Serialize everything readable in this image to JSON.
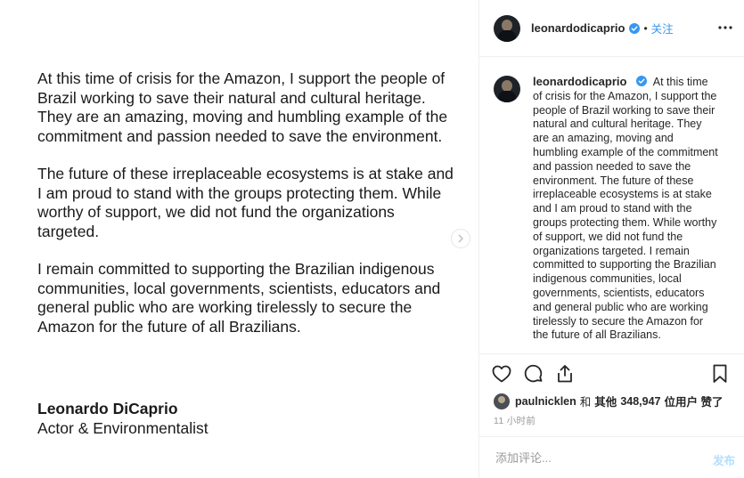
{
  "image": {
    "paragraphs": [
      "At this time of crisis for the Amazon, I support the people of Brazil working to save their natural and cultural heritage. They are an amazing, moving and humbling example of the commitment and passion needed to save the environment.",
      "The future of these irreplaceable ecosystems is at stake and I am proud to stand with the groups protecting them. While worthy of support, we did not fund the organizations targeted.",
      "I remain committed to supporting the Brazilian indigenous communities, local governments, scientists, educators and general public who are working tirelessly to secure the Amazon for the future of all Brazilians."
    ],
    "signature_name": "Leonardo DiCaprio",
    "signature_title": "Actor & Environmentalist"
  },
  "header": {
    "username": "leonardodicaprio",
    "separator": "•",
    "follow_label": "关注"
  },
  "caption": {
    "username": "leonardodicaprio",
    "text": "At this time of crisis for the Amazon, I support the people of Brazil working to save their natural and cultural heritage. They are an amazing, moving and humbling example of the commitment and passion needed to save the environment. The future of these irreplaceable ecosystems is at stake and I am proud to stand with the groups protecting them. While worthy of support, we did not fund the organizations targeted. I remain committed to supporting the Brazilian indigenous communities, local governments, scientists, educators and general public who are working tirelessly to secure the Amazon for the future of all Brazilians."
  },
  "likes": {
    "user": "paulnicklen",
    "connector": "和",
    "others_label": "其他",
    "count": "348,947",
    "suffix": "位用户 赞了"
  },
  "timestamp": "11 小时前",
  "comment_box": {
    "placeholder": "添加评论...",
    "post_label": "发布"
  },
  "icons": {
    "next": "chevron-right-icon",
    "more": "more-options-icon",
    "verified": "verified-badge-icon",
    "like": "heart-icon",
    "comment": "comment-bubble-icon",
    "share": "share-icon",
    "save": "bookmark-icon"
  },
  "colors": {
    "link": "#3897f0",
    "verified": "#3897f0",
    "muted": "#999999",
    "post_disabled": "#b2dffc",
    "border": "#efefef"
  }
}
